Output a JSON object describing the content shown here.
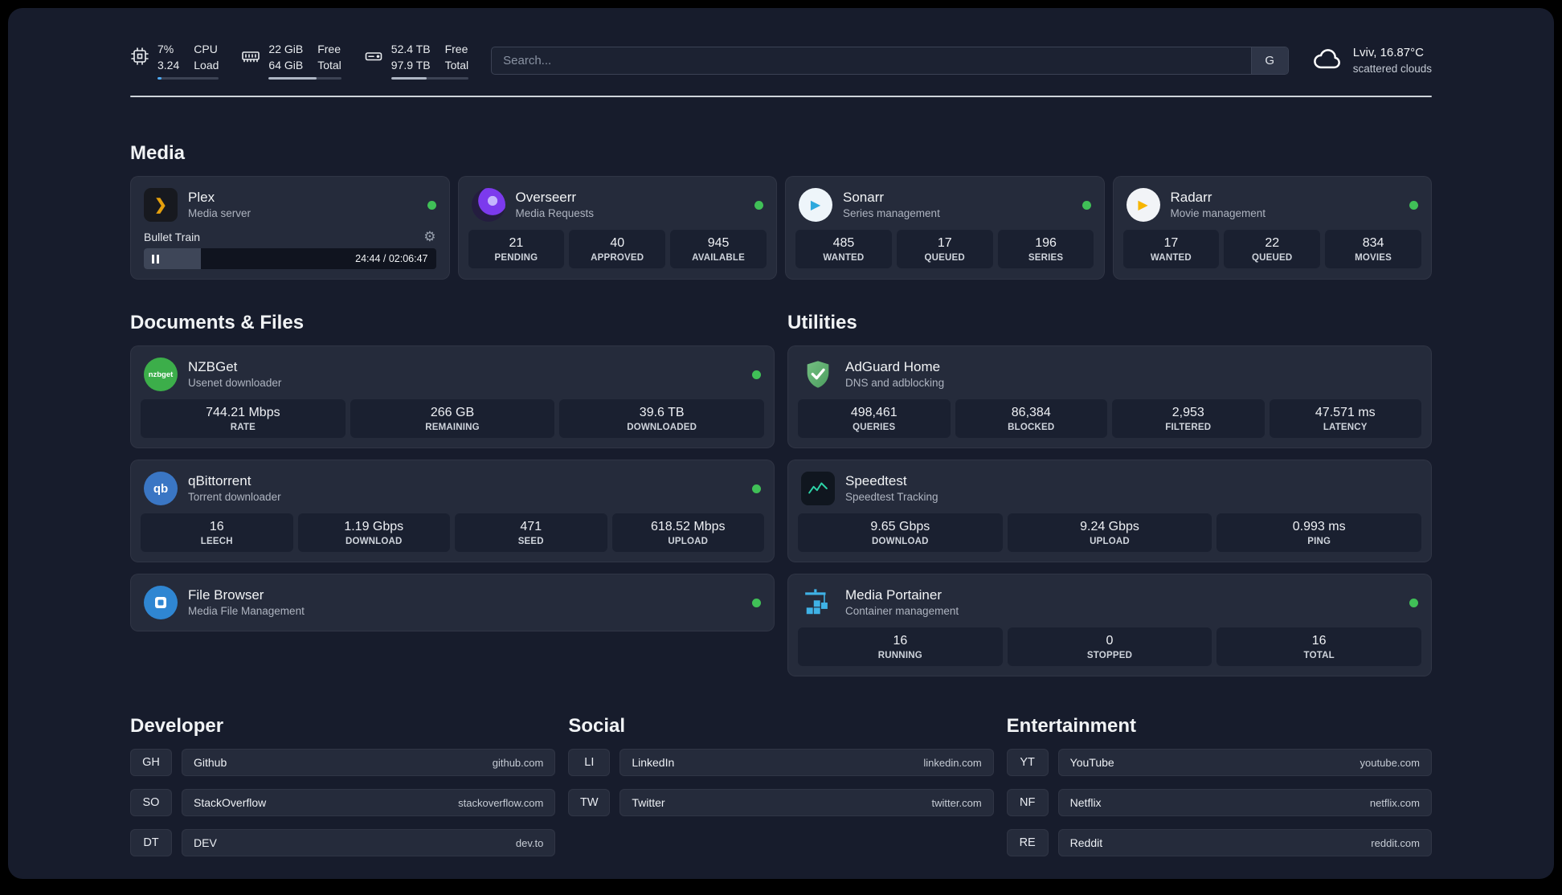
{
  "colors": {
    "status_online": "#40c057",
    "cpu_accent": "#4dabf7",
    "background": "#171c2c",
    "card": "#252b3b"
  },
  "topbar": {
    "cpu": {
      "icon": "chip-icon",
      "percent": "7%",
      "load": "3.24",
      "label_top": "CPU",
      "label_bottom": "Load",
      "progress": 7
    },
    "ram": {
      "icon": "memory-icon",
      "free": "22 GiB",
      "total": "64 GiB",
      "label_top": "Free",
      "label_bottom": "Total",
      "progress": 66
    },
    "disk": {
      "icon": "hard-drive-icon",
      "free": "52.4 TB",
      "total": "97.9 TB",
      "label_top": "Free",
      "label_bottom": "Total",
      "progress": 46
    },
    "search": {
      "placeholder": "Search...",
      "button_label": "G"
    },
    "weather": {
      "icon": "cloud-icon",
      "location": "Lviv, 16.87°C",
      "condition": "scattered clouds"
    }
  },
  "sections": {
    "media": "Media",
    "documents": "Documents & Files",
    "utilities": "Utilities",
    "developer": "Developer",
    "social": "Social",
    "entertainment": "Entertainment"
  },
  "ui": {
    "gear": "⚙"
  },
  "apps": {
    "plex": {
      "icon": "plex-icon",
      "icon_text": "❯",
      "name": "Plex",
      "desc": "Media server",
      "player": {
        "track": "Bullet Train",
        "time": "24:44 / 02:06:47",
        "progress": 19.5
      }
    },
    "overseerr": {
      "icon": "overseerr-icon",
      "name": "Overseerr",
      "desc": "Media Requests",
      "stats": [
        {
          "value": "21",
          "label": "PENDING"
        },
        {
          "value": "40",
          "label": "APPROVED"
        },
        {
          "value": "945",
          "label": "AVAILABLE"
        }
      ]
    },
    "sonarr": {
      "icon": "sonarr-icon",
      "icon_text": "▶",
      "name": "Sonarr",
      "desc": "Series management",
      "stats": [
        {
          "value": "485",
          "label": "WANTED"
        },
        {
          "value": "17",
          "label": "QUEUED"
        },
        {
          "value": "196",
          "label": "SERIES"
        }
      ]
    },
    "radarr": {
      "icon": "radarr-icon",
      "icon_text": "▶",
      "name": "Radarr",
      "desc": "Movie management",
      "stats": [
        {
          "value": "17",
          "label": "WANTED"
        },
        {
          "value": "22",
          "label": "QUEUED"
        },
        {
          "value": "834",
          "label": "MOVIES"
        }
      ]
    },
    "nzbget": {
      "icon": "nzbget-icon",
      "icon_text": "nzbget",
      "name": "NZBGet",
      "desc": "Usenet downloader",
      "stats": [
        {
          "value": "744.21 Mbps",
          "label": "RATE"
        },
        {
          "value": "266 GB",
          "label": "REMAINING"
        },
        {
          "value": "39.6 TB",
          "label": "DOWNLOADED"
        }
      ]
    },
    "qbittorrent": {
      "icon": "qbittorrent-icon",
      "icon_text": "qb",
      "name": "qBittorrent",
      "desc": "Torrent downloader",
      "stats": [
        {
          "value": "16",
          "label": "LEECH"
        },
        {
          "value": "1.19 Gbps",
          "label": "DOWNLOAD"
        },
        {
          "value": "471",
          "label": "SEED"
        },
        {
          "value": "618.52 Mbps",
          "label": "UPLOAD"
        }
      ]
    },
    "filebrowser": {
      "icon": "filebrowser-icon",
      "name": "File Browser",
      "desc": "Media File Management"
    },
    "adguard": {
      "icon": "adguard-shield-icon",
      "name": "AdGuard Home",
      "desc": "DNS and adblocking",
      "stats": [
        {
          "value": "498,461",
          "label": "QUERIES"
        },
        {
          "value": "86,384",
          "label": "BLOCKED"
        },
        {
          "value": "2,953",
          "label": "FILTERED"
        },
        {
          "value": "47.571 ms",
          "label": "LATENCY"
        }
      ]
    },
    "speedtest": {
      "icon": "speedtest-graph-icon",
      "name": "Speedtest",
      "desc": "Speedtest Tracking",
      "stats": [
        {
          "value": "9.65 Gbps",
          "label": "DOWNLOAD"
        },
        {
          "value": "9.24 Gbps",
          "label": "UPLOAD"
        },
        {
          "value": "0.993 ms",
          "label": "PING"
        }
      ]
    },
    "portainer": {
      "icon": "portainer-crane-icon",
      "name": "Media Portainer",
      "desc": "Container management",
      "stats": [
        {
          "value": "16",
          "label": "RUNNING"
        },
        {
          "value": "0",
          "label": "STOPPED"
        },
        {
          "value": "16",
          "label": "TOTAL"
        }
      ]
    }
  },
  "links": {
    "developer": [
      {
        "abbr": "GH",
        "name": "Github",
        "url": "github.com"
      },
      {
        "abbr": "SO",
        "name": "StackOverflow",
        "url": "stackoverflow.com"
      },
      {
        "abbr": "DT",
        "name": "DEV",
        "url": "dev.to"
      }
    ],
    "social": [
      {
        "abbr": "LI",
        "name": "LinkedIn",
        "url": "linkedin.com"
      },
      {
        "abbr": "TW",
        "name": "Twitter",
        "url": "twitter.com"
      }
    ],
    "entertainment": [
      {
        "abbr": "YT",
        "name": "YouTube",
        "url": "youtube.com"
      },
      {
        "abbr": "NF",
        "name": "Netflix",
        "url": "netflix.com"
      },
      {
        "abbr": "RE",
        "name": "Reddit",
        "url": "reddit.com"
      }
    ]
  }
}
